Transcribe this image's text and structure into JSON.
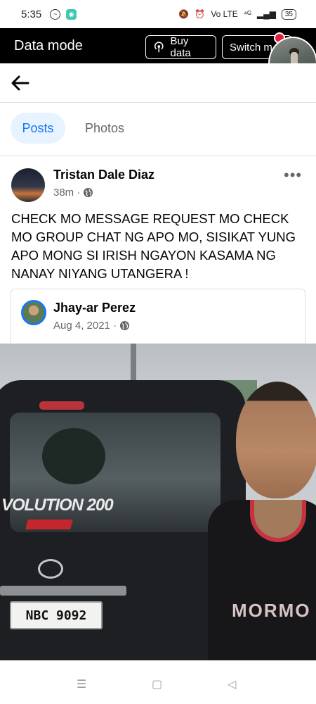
{
  "status_bar": {
    "time": "5:35",
    "right_labels": [
      "Vo LTE",
      "⁴ᴳ",
      "35"
    ]
  },
  "data_bar": {
    "title": "Data mode",
    "buy_label": "Buy data",
    "switch_label": "Switch m"
  },
  "tabs": [
    {
      "label": "Posts",
      "selected": true
    },
    {
      "label": "Photos",
      "selected": false
    }
  ],
  "post": {
    "author": "Tristan Dale Diaz",
    "time": "38m ·",
    "text": "CHECK MO MESSAGE REQUEST MO CHECK MO GROUP CHAT NG APO MO, SISIKAT YUNG APO MONG SI IRISH NGAYON KASAMA NG NANAY NIYANG UTANGERA !",
    "shared": {
      "author": "Jhay-ar Perez",
      "date": "Aug 4, 2021 ·"
    },
    "photo": {
      "decal": "VOLUTION 200",
      "plate": "NBC 9092",
      "jersey": "MORMO"
    }
  },
  "colors": {
    "accent": "#1877f2",
    "tab_bg": "#e7f3ff",
    "secondary_text": "#65676b"
  }
}
